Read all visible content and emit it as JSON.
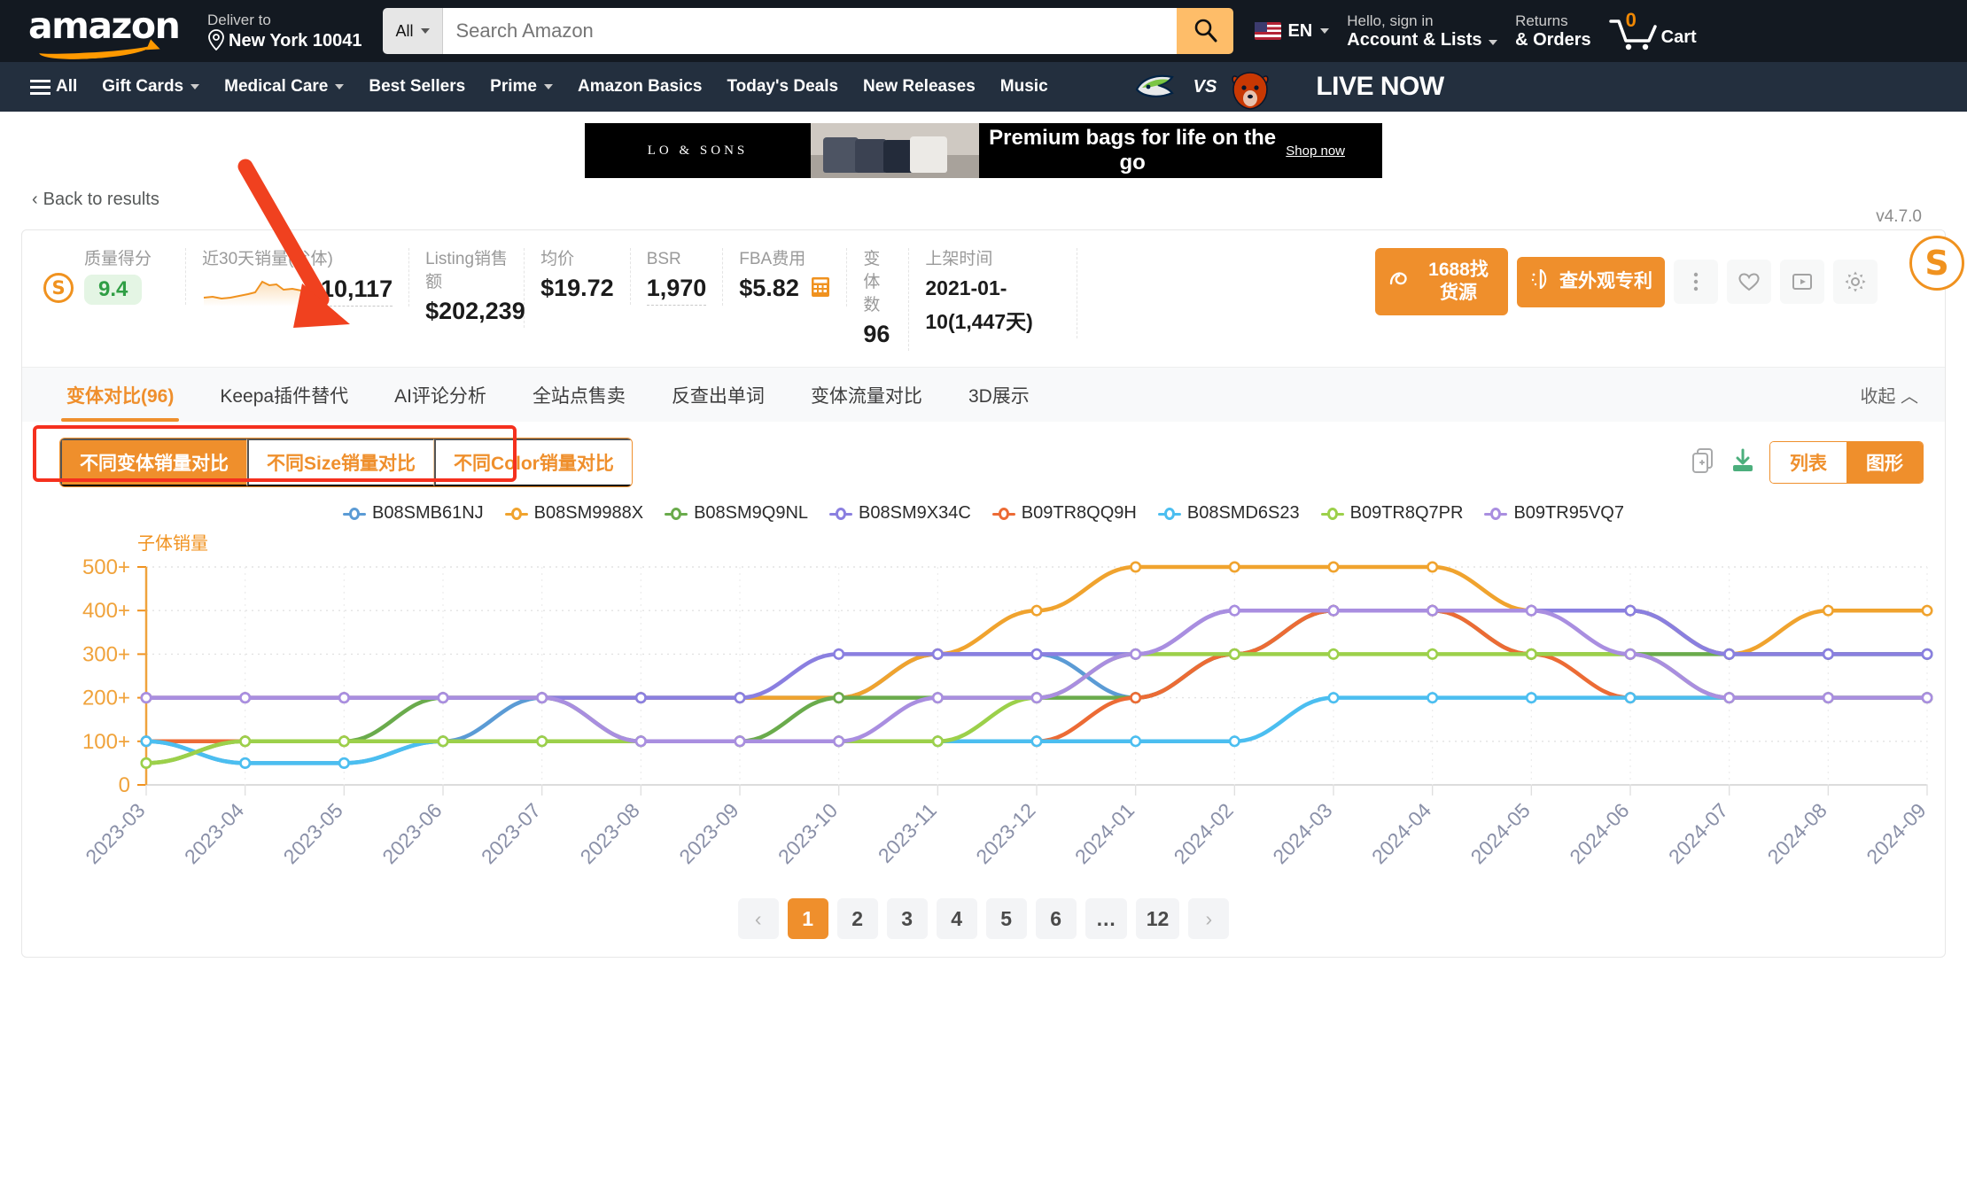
{
  "amazon_nav": {
    "logo_text": "amazon",
    "deliver_to_label": "Deliver to",
    "deliver_to_value": "New York 10041",
    "search_category": "All",
    "search_placeholder": "Search Amazon",
    "search_icon": "magnifier-icon",
    "language": "EN",
    "account_line1": "Hello, sign in",
    "account_line2": "Account & Lists",
    "returns_line1": "Returns",
    "returns_line2": "& Orders",
    "cart_count": "0",
    "cart_label": "Cart",
    "menu_all": "All",
    "menu_items": [
      "Gift Cards",
      "Medical Care",
      "Best Sellers",
      "Prime",
      "Amazon Basics",
      "Today's Deals",
      "New Releases",
      "Music"
    ],
    "menu_with_caret": [
      "Gift Cards",
      "Medical Care",
      "Prime"
    ],
    "nfl_vs": "VS",
    "live_now": "LIVE NOW"
  },
  "ad_banner": {
    "brand": "LO & SONS",
    "headline": "Premium bags for life on the go",
    "cta": "Shop now"
  },
  "breadcrumb": {
    "back_label": "Back to results"
  },
  "panel": {
    "version": "v4.7.0",
    "badge_letter": "S",
    "metrics": [
      {
        "label": "质量得分",
        "value": "9.4",
        "type": "score"
      },
      {
        "label": "近30天销量(父体)",
        "value": "10,117",
        "type": "sparkline"
      },
      {
        "label": "Listing销售额",
        "value": "$202,239",
        "type": "plain"
      },
      {
        "label": "均价",
        "value": "$19.72",
        "type": "plain"
      },
      {
        "label": "BSR",
        "value": "1,970",
        "type": "dashed"
      },
      {
        "label": "FBA费用",
        "value": "$5.82",
        "type": "calc"
      },
      {
        "label": "变体数",
        "value": "96",
        "type": "plain"
      },
      {
        "label": "上架时间",
        "value": "2021-01-10(1,447天)",
        "type": "plain"
      }
    ],
    "buttons": {
      "find_source": "1688找货源",
      "check_patent": "查外观专利"
    },
    "icon_buttons": [
      "more-vertical-icon",
      "heart-icon",
      "play-icon",
      "gear-icon"
    ],
    "tabs": [
      {
        "label": "变体对比(96)",
        "active": true
      },
      {
        "label": "Keepa插件替代",
        "active": false
      },
      {
        "label": "AI评论分析",
        "active": false
      },
      {
        "label": "全站点售卖",
        "active": false
      },
      {
        "label": "反查出单词",
        "active": false
      },
      {
        "label": "变体流量对比",
        "active": false
      },
      {
        "label": "3D展示",
        "active": false
      }
    ],
    "collapse_label": "收起"
  },
  "toolbar": {
    "segments": [
      {
        "label": "不同变体销量对比",
        "active": true
      },
      {
        "label": "不同Size销量对比",
        "active": false
      },
      {
        "label": "不同Color销量对比",
        "active": false
      }
    ],
    "copy_icon": "copy-icon",
    "download_icon": "download-icon",
    "views": [
      {
        "label": "列表",
        "active": false
      },
      {
        "label": "图形",
        "active": true
      }
    ]
  },
  "pagination": {
    "prev_icon": "chevron-left-icon",
    "next_icon": "chevron-right-icon",
    "pages": [
      "1",
      "2",
      "3",
      "4",
      "5",
      "6",
      "…",
      "12"
    ],
    "current": "1"
  },
  "chart_data": {
    "type": "line",
    "title": "子体销量",
    "xlabel": "",
    "ylabel": "子体销量",
    "ylim": [
      0,
      500
    ],
    "ytick_labels": [
      "0",
      "100+",
      "200+",
      "300+",
      "400+",
      "500+"
    ],
    "ytick_values": [
      0,
      100,
      200,
      300,
      400,
      500
    ],
    "grid": true,
    "legend_position": "top",
    "categories": [
      "2023-03",
      "2023-04",
      "2023-05",
      "2023-06",
      "2023-07",
      "2023-08",
      "2023-09",
      "2023-10",
      "2023-11",
      "2023-12",
      "2024-01",
      "2024-02",
      "2024-03",
      "2024-04",
      "2024-05",
      "2024-06",
      "2024-07",
      "2024-08",
      "2024-09"
    ],
    "series": [
      {
        "name": "B08SMB61NJ",
        "color": "#5b9bd5",
        "values": [
          100,
          50,
          50,
          100,
          200,
          200,
          200,
          200,
          300,
          300,
          200,
          300,
          400,
          400,
          400,
          400,
          300,
          300,
          300
        ]
      },
      {
        "name": "B08SM9988X",
        "color": "#f0a32e",
        "values": [
          200,
          200,
          200,
          200,
          200,
          200,
          200,
          200,
          300,
          400,
          500,
          500,
          500,
          500,
          400,
          400,
          300,
          400,
          400
        ]
      },
      {
        "name": "B08SM9Q9NL",
        "color": "#6aab4c",
        "values": [
          50,
          100,
          100,
          200,
          200,
          100,
          100,
          200,
          200,
          200,
          200,
          300,
          400,
          400,
          300,
          300,
          300,
          300,
          300
        ]
      },
      {
        "name": "B08SM9X34C",
        "color": "#8a7fe0",
        "values": [
          200,
          200,
          200,
          200,
          200,
          200,
          200,
          300,
          300,
          300,
          300,
          400,
          400,
          400,
          400,
          400,
          300,
          300,
          300
        ]
      },
      {
        "name": "B09TR8QQ9H",
        "color": "#ec6b35",
        "values": [
          100,
          100,
          100,
          100,
          100,
          100,
          100,
          100,
          100,
          100,
          200,
          300,
          400,
          400,
          300,
          200,
          200,
          200,
          200
        ]
      },
      {
        "name": "B08SMD6S23",
        "color": "#4bbef0",
        "values": [
          100,
          50,
          50,
          100,
          100,
          100,
          100,
          100,
          100,
          100,
          100,
          100,
          200,
          200,
          200,
          200,
          200,
          200,
          200
        ]
      },
      {
        "name": "B09TR8Q7PR",
        "color": "#9cd04a",
        "values": [
          50,
          100,
          100,
          100,
          100,
          100,
          100,
          100,
          100,
          200,
          300,
          300,
          300,
          300,
          300,
          300,
          200,
          200,
          200
        ]
      },
      {
        "name": "B09TR95VQ7",
        "color": "#a98ee0",
        "values": [
          200,
          200,
          200,
          200,
          200,
          100,
          100,
          100,
          200,
          200,
          300,
          400,
          400,
          400,
          400,
          300,
          200,
          200,
          200
        ]
      }
    ]
  }
}
